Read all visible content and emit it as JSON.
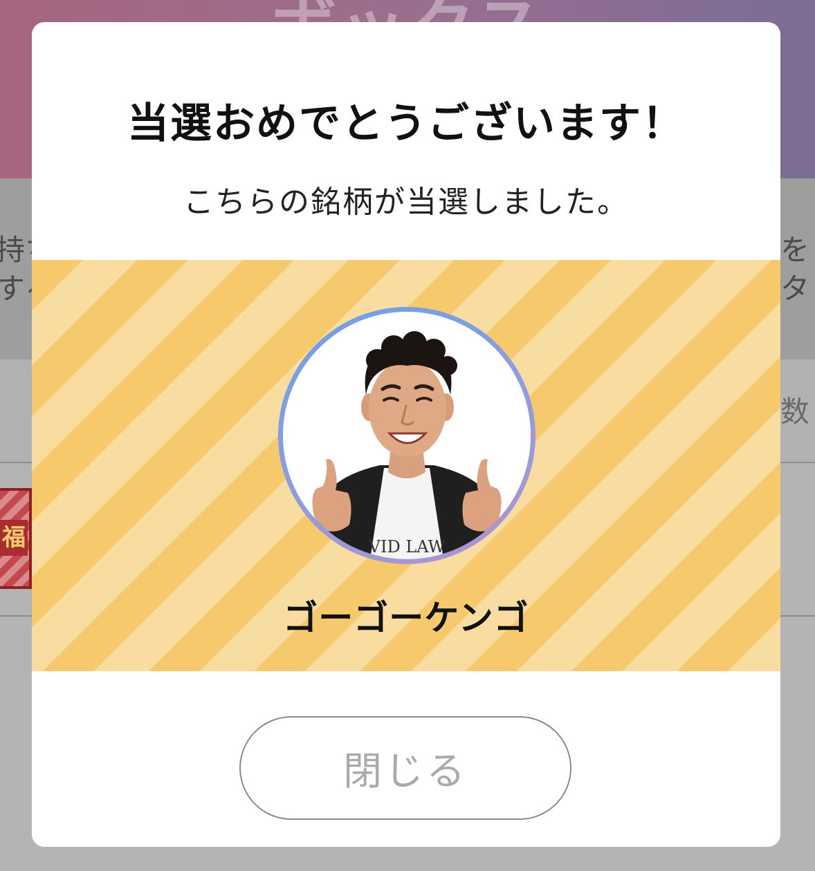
{
  "background": {
    "header_title": "ボックス",
    "text_left_line1": "持ち",
    "text_left_line2": "する",
    "text_right_line1": "をタ",
    "column_right": "数",
    "thumb_label": "福"
  },
  "modal": {
    "title": "当選おめでとうございます！",
    "subtitle": "こちらの銘柄が当選しました。",
    "winner": {
      "name": "ゴーゴーケンゴ",
      "shirt_text": "VID LAW"
    },
    "close_label": "閉じる"
  },
  "colors": {
    "stripe_dark": "#f6ca6c",
    "stripe_light": "#f8dca0",
    "ring_start": "#6aa0e8",
    "ring_end": "#b492d0",
    "header_gradient_left": "#a6667f",
    "header_gradient_right": "#7b6d96"
  }
}
